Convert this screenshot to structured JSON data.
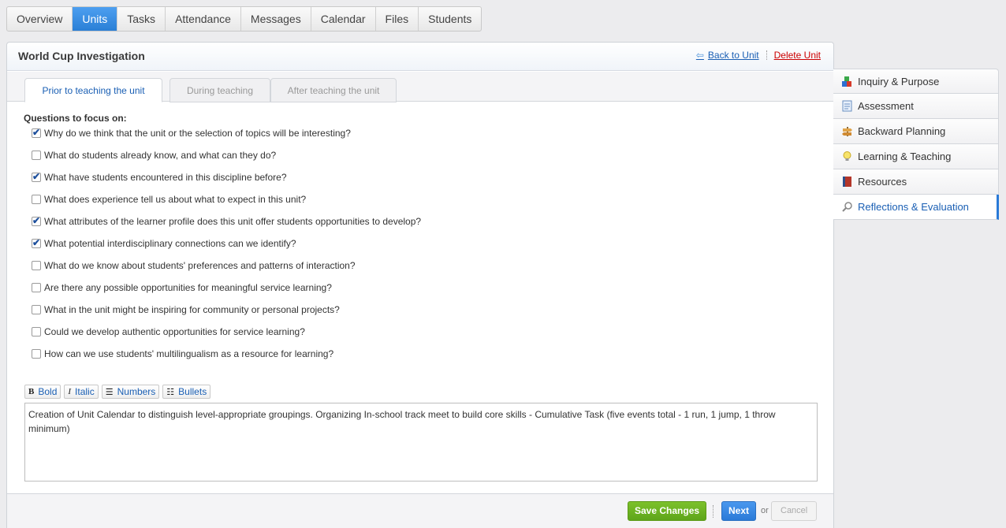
{
  "topnav": {
    "tabs": [
      "Overview",
      "Units",
      "Tasks",
      "Attendance",
      "Messages",
      "Calendar",
      "Files",
      "Students"
    ],
    "active": "Units"
  },
  "unit": {
    "title": "World Cup Investigation",
    "back_link": "Back to Unit",
    "delete_link": "Delete Unit"
  },
  "subtabs": [
    "Prior to teaching the unit",
    "During teaching",
    "After teaching the unit"
  ],
  "questions": {
    "heading": "Questions to focus on:",
    "items": [
      {
        "text": "Why do we think that the unit or the selection of topics will be interesting?",
        "checked": true
      },
      {
        "text": "What do students already know, and what can they do?",
        "checked": false
      },
      {
        "text": "What have students encountered in this discipline before?",
        "checked": true
      },
      {
        "text": "What does experience tell us about what to expect in this unit?",
        "checked": false
      },
      {
        "text": "What attributes of the learner profile does this unit offer students opportunities to develop?",
        "checked": true
      },
      {
        "text": "What potential interdisciplinary connections can we identify?",
        "checked": true
      },
      {
        "text": "What do we know about students' preferences and patterns of interaction?",
        "checked": false
      },
      {
        "text": "Are there any possible opportunities for meaningful service learning?",
        "checked": false
      },
      {
        "text": "What in the unit might be inspiring for community or personal projects?",
        "checked": false
      },
      {
        "text": "Could we develop authentic opportunities for service learning?",
        "checked": false
      },
      {
        "text": "How can we use students' multilingualism as a resource for learning?",
        "checked": false
      }
    ]
  },
  "toolbar": {
    "bold": "Bold",
    "italic": "Italic",
    "numbers": "Numbers",
    "bullets": "Bullets"
  },
  "editor": {
    "text": "Creation of Unit Calendar to distinguish level-appropriate groupings. Organizing In-school track meet to build core skills - Cumulative Task (five events total - 1 run, 1 jump, 1 throw minimum)"
  },
  "footer": {
    "save": "Save Changes",
    "next": "Next",
    "or": "or",
    "cancel": "Cancel"
  },
  "sidebar": {
    "items": [
      {
        "label": "Inquiry & Purpose",
        "icon": "blocks-icon"
      },
      {
        "label": "Assessment",
        "icon": "document-icon"
      },
      {
        "label": "Backward Planning",
        "icon": "signpost-icon"
      },
      {
        "label": "Learning & Teaching",
        "icon": "lightbulb-icon"
      },
      {
        "label": "Resources",
        "icon": "book-icon"
      },
      {
        "label": "Reflections & Evaluation",
        "icon": "magnifier-icon"
      }
    ],
    "active": "Reflections & Evaluation"
  },
  "colors": {
    "accent": "#2a7ad8",
    "save_green": "#6db322",
    "delete_red": "#cc0000",
    "link_blue": "#1a5fb4"
  }
}
